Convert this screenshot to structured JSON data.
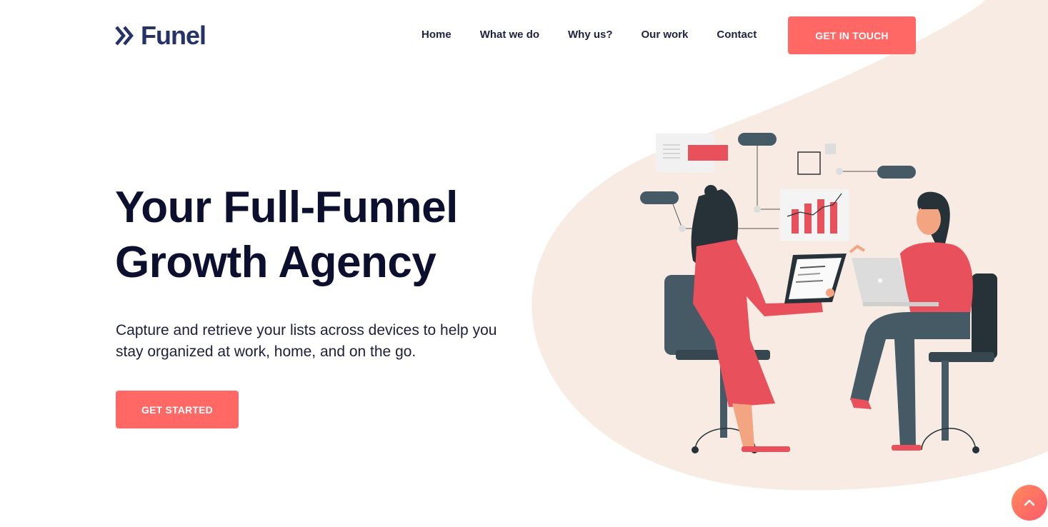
{
  "brand": {
    "name": "Funel",
    "accent": "#ff6865",
    "navy": "#26326a",
    "blob": "#f7ebe3"
  },
  "nav": {
    "items": [
      {
        "label": "Home"
      },
      {
        "label": "What we do"
      },
      {
        "label": "Why us?"
      },
      {
        "label": "Our work"
      },
      {
        "label": "Contact"
      }
    ],
    "cta_label": "GET IN TOUCH"
  },
  "hero": {
    "title": "Your Full-Funnel Growth Agency",
    "subtitle": "Capture and retrieve your lists across devices to help you stay organized at work, home, and on the go.",
    "cta_label": "GET STARTED"
  },
  "icons": {
    "logo": "double-chevron-right-icon",
    "scroll_top": "chevron-up-icon"
  }
}
